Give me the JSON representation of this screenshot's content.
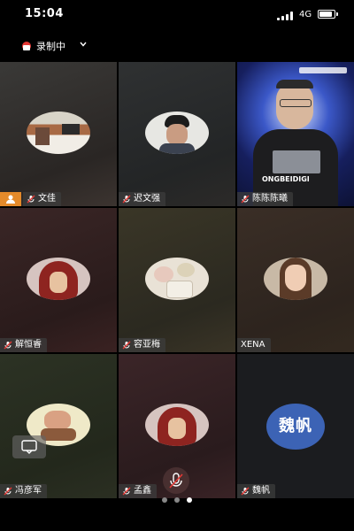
{
  "status_bar": {
    "time": "15:04",
    "network": "4G"
  },
  "recording": {
    "label": "录制中"
  },
  "participants": [
    {
      "name": "文佳",
      "muted": true,
      "host": true,
      "avatar": "photo-living-room"
    },
    {
      "name": "迟文强",
      "muted": true,
      "avatar": "photo-young-man"
    },
    {
      "name": "陈陈陈曦",
      "muted": true,
      "avatar": "video-camera-feed"
    },
    {
      "name": "解恒睿",
      "muted": true,
      "avatar": "photo-red-hooded-figure"
    },
    {
      "name": "容亚梅",
      "muted": true,
      "avatar": "photo-flowers-cup"
    },
    {
      "name": "XENA",
      "muted": false,
      "avatar": "photo-woman"
    },
    {
      "name": "冯彦军",
      "muted": true,
      "avatar": "photo-figurine"
    },
    {
      "name": "孟鑫",
      "muted": true,
      "avatar": "photo-red-hooded-figure"
    },
    {
      "name": "魏帆",
      "muted": true,
      "avatar_text": "魏帆"
    }
  ],
  "camera_banner": {
    "text": "ONGBEIDIGI"
  },
  "pager": {
    "pages": 3,
    "current": 3
  },
  "colors": {
    "host_badge": "#e48a2a",
    "text_avatar": "#3c63b5"
  }
}
